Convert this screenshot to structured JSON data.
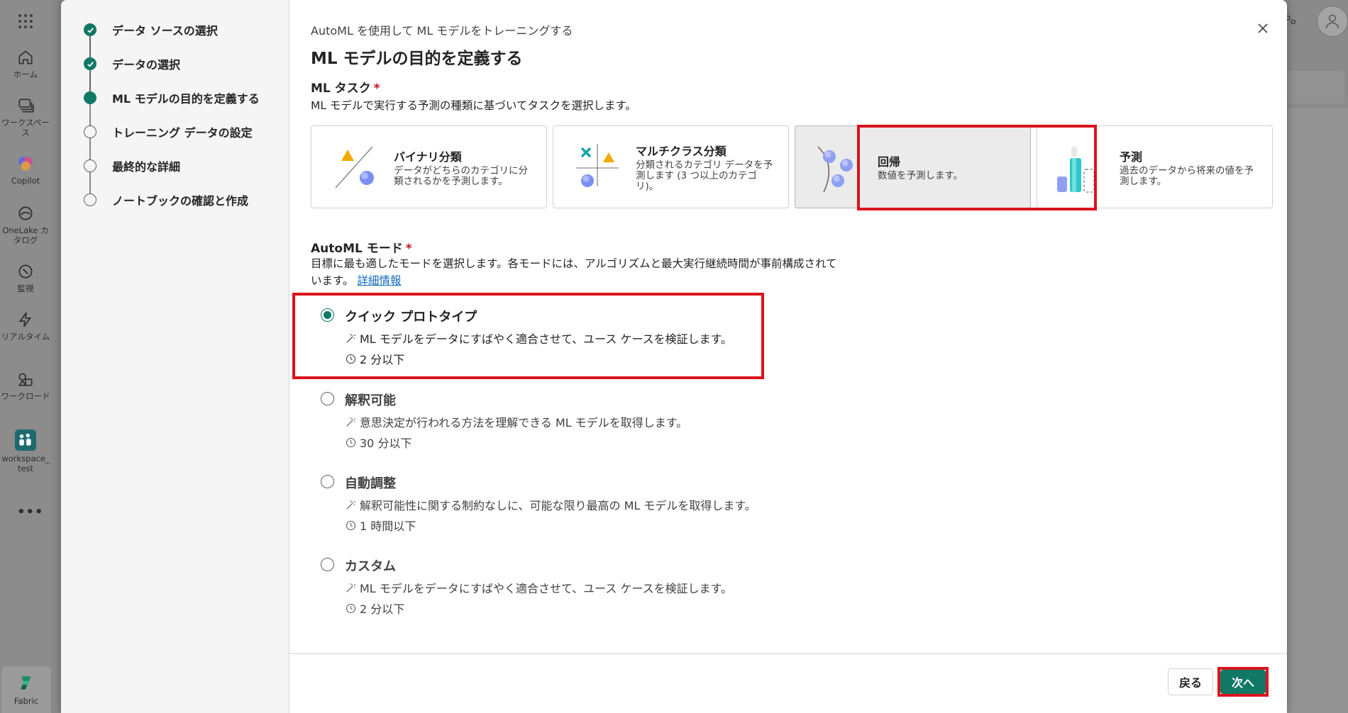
{
  "rail": {
    "items": [
      {
        "label": "ホーム",
        "icon": "home-icon"
      },
      {
        "label": "ワークスペース",
        "icon": "workspaces-icon"
      },
      {
        "label": "Copilot",
        "icon": "copilot-icon"
      },
      {
        "label": "OneLake カタログ",
        "icon": "onelake-icon"
      },
      {
        "label": "監視",
        "icon": "monitor-icon"
      },
      {
        "label": "リアルタイム",
        "icon": "realtime-icon"
      },
      {
        "label": "ワークロード",
        "icon": "workload-icon"
      },
      {
        "label": "workspace_test",
        "icon": "workspace-tile-icon"
      }
    ],
    "more": "•••",
    "fabric_label": "Fabric"
  },
  "steps": [
    {
      "label": "データ ソースの選択",
      "state": "done"
    },
    {
      "label": "データの選択",
      "state": "done"
    },
    {
      "label": "ML モデルの目的を定義する",
      "state": "current"
    },
    {
      "label": "トレーニング データの設定",
      "state": "pending"
    },
    {
      "label": "最終的な詳細",
      "state": "pending"
    },
    {
      "label": "ノートブックの確認と作成",
      "state": "pending"
    }
  ],
  "header": {
    "subtitle": "AutoML を使用して ML モデルをトレーニングする",
    "title": "ML モデルの目的を定義する"
  },
  "ml_task": {
    "heading": "ML タスク",
    "required_mark": "*",
    "description": "ML モデルで実行する予測の種類に基づいてタスクを選択します。",
    "cards": [
      {
        "name": "バイナリ分類",
        "desc": "データがどちらのカテゴリに分類されるかを予測します。",
        "icon": "binary-classification-icon",
        "selected": false
      },
      {
        "name": "マルチクラス分類",
        "desc": "分類されるカテゴリ データを予測します (3 つ以上のカテゴリ)。",
        "icon": "multiclass-classification-icon",
        "selected": false
      },
      {
        "name": "回帰",
        "desc": "数値を予測します。",
        "icon": "regression-icon",
        "selected": true
      },
      {
        "name": "予測",
        "desc": "過去のデータから将来の値を予測します。",
        "icon": "forecasting-icon",
        "selected": false
      }
    ]
  },
  "automl_mode": {
    "heading": "AutoML モード",
    "required_mark": "*",
    "description_1": "目標に最も適したモードを選択します。各モードには、アルゴリズムと最大実行継続時間が事前構成されて",
    "description_2": "います。",
    "learn_more": "詳細情報",
    "modes": [
      {
        "name": "クイック プロトタイプ",
        "desc": "ML モデルをデータにすばやく適合させて、ユース ケースを検証します。",
        "time": "2 分以下",
        "checked": true
      },
      {
        "name": "解釈可能",
        "desc": "意思決定が行われる方法を理解できる ML モデルを取得します。",
        "time": "30 分以下",
        "checked": false
      },
      {
        "name": "自動調整",
        "desc": "解釈可能性に関する制約なしに、可能な限り最高の ML モデルを取得します。",
        "time": "1 時間以下",
        "checked": false
      },
      {
        "name": "カスタム",
        "desc": "ML モデルをデータにすばやく適合させて、ユース ケースを検証します。",
        "time": "2 分以下",
        "checked": false
      }
    ]
  },
  "footer": {
    "back_label": "戻る",
    "next_label": "次へ"
  },
  "colors": {
    "accent": "#117865",
    "highlight": "#d9141c",
    "required": "#c50f1f",
    "link": "#0f6cbd"
  }
}
